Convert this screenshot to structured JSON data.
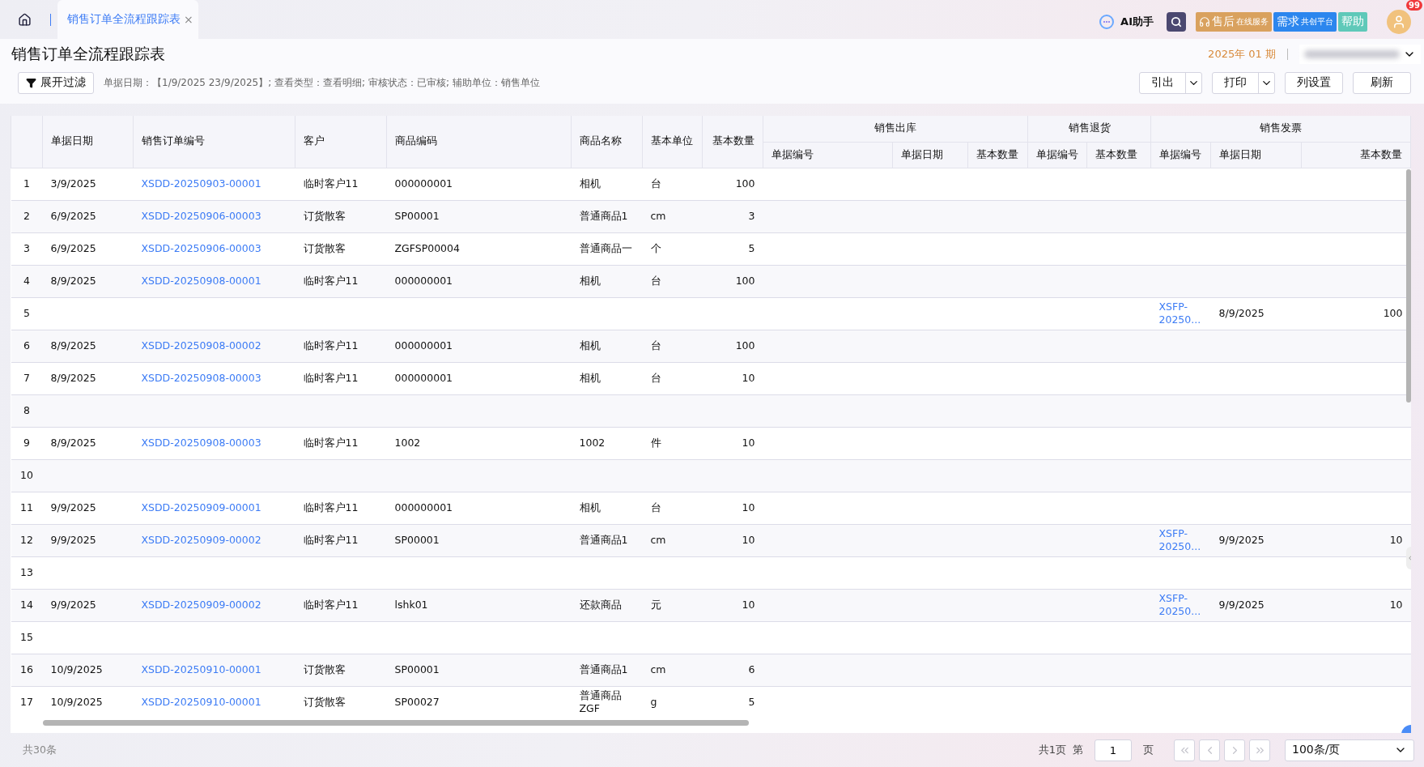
{
  "top_bar": {
    "tab": {
      "label": "销售订单全流程跟踪表",
      "close": "×",
      "selected": true
    },
    "ai_label": "AI助手",
    "service_button": {
      "main": "售后",
      "sub": "在线服务"
    },
    "platform_button": {
      "main": "需求",
      "sub": "共创平台"
    },
    "help_button": "帮助",
    "badge": "99"
  },
  "page": {
    "title": "销售订单全流程跟踪表",
    "period": "2025年 01 期"
  },
  "toolbar": {
    "filter_button": "展开过滤",
    "summary": "单据日期：【1/9/2025 23/9/2025】; 查看类型：查看明细; 审核状态：已审核; 辅助单位：销售单位",
    "buttons": [
      {
        "label": "引出",
        "kind": "split"
      },
      {
        "label": "打印",
        "kind": "split"
      },
      {
        "label": "列设置",
        "kind": "plain"
      },
      {
        "label": "刷新",
        "kind": "plain"
      }
    ]
  },
  "table": {
    "columns": [
      {
        "label": "单据日期"
      },
      {
        "label": "销售订单编号"
      },
      {
        "label": "客户"
      },
      {
        "label": "商品编码"
      },
      {
        "label": "商品名称"
      },
      {
        "label": "基本单位"
      },
      {
        "label": "基本数量"
      },
      {
        "label": "销售出库",
        "children": [
          {
            "label": "单据编号"
          },
          {
            "label": "单据日期"
          },
          {
            "label": "基本数量"
          }
        ]
      },
      {
        "label": "销售退货",
        "children": [
          {
            "label": "单据编号"
          },
          {
            "label": "基本数量"
          }
        ]
      },
      {
        "label": "销售发票",
        "children": [
          {
            "label": "单据编号"
          },
          {
            "label": "单据日期"
          },
          {
            "label": "基本数量"
          }
        ]
      }
    ],
    "rows": [
      {
        "no": "1",
        "date": "3/9/2025",
        "order_no": "XSDD-20250903-00001",
        "customer": "临时客户11",
        "item_code": "000000001",
        "item_name": "相机",
        "unit": "台",
        "qty": "100"
      },
      {
        "no": "2",
        "date": "6/9/2025",
        "order_no": "XSDD-20250906-00003",
        "customer": "订货散客",
        "item_code": "SP00001",
        "item_name": "普通商品1",
        "unit": "cm",
        "qty": "3"
      },
      {
        "no": "3",
        "date": "6/9/2025",
        "order_no": "XSDD-20250906-00003",
        "customer": "订货散客",
        "item_code": "ZGFSP00004",
        "item_name": "普通商品一",
        "unit": "个",
        "qty": "5"
      },
      {
        "no": "4",
        "date": "8/9/2025",
        "order_no": "XSDD-20250908-00001",
        "customer": "临时客户11",
        "item_code": "000000001",
        "item_name": "相机",
        "unit": "台",
        "qty": "100"
      },
      {
        "no": "5",
        "invoice_no": "XSFP-20250...",
        "invoice_date": "8/9/2025",
        "invoice_qty": "100"
      },
      {
        "no": "6",
        "date": "8/9/2025",
        "order_no": "XSDD-20250908-00002",
        "customer": "临时客户11",
        "item_code": "000000001",
        "item_name": "相机",
        "unit": "台",
        "qty": "100"
      },
      {
        "no": "7",
        "date": "8/9/2025",
        "order_no": "XSDD-20250908-00003",
        "customer": "临时客户11",
        "item_code": "000000001",
        "item_name": "相机",
        "unit": "台",
        "qty": "10"
      },
      {
        "no": "8"
      },
      {
        "no": "9",
        "date": "8/9/2025",
        "order_no": "XSDD-20250908-00003",
        "customer": "临时客户11",
        "item_code": "1002",
        "item_name": "1002",
        "unit": "件",
        "qty": "10"
      },
      {
        "no": "10"
      },
      {
        "no": "11",
        "date": "9/9/2025",
        "order_no": "XSDD-20250909-00001",
        "customer": "临时客户11",
        "item_code": "000000001",
        "item_name": "相机",
        "unit": "台",
        "qty": "10"
      },
      {
        "no": "12",
        "date": "9/9/2025",
        "order_no": "XSDD-20250909-00002",
        "customer": "临时客户11",
        "item_code": "SP00001",
        "item_name": "普通商品1",
        "unit": "cm",
        "qty": "10",
        "invoice_no": "XSFP-20250...",
        "invoice_date": "9/9/2025",
        "invoice_qty": "10"
      },
      {
        "no": "13"
      },
      {
        "no": "14",
        "date": "9/9/2025",
        "order_no": "XSDD-20250909-00002",
        "customer": "临时客户11",
        "item_code": "lshk01",
        "item_name": "还款商品",
        "unit": "元",
        "qty": "10",
        "invoice_no": "XSFP-20250...",
        "invoice_date": "9/9/2025",
        "invoice_qty": "10"
      },
      {
        "no": "15"
      },
      {
        "no": "16",
        "date": "10/9/2025",
        "order_no": "XSDD-20250910-00001",
        "customer": "订货散客",
        "item_code": "SP00001",
        "item_name": "普通商品1",
        "unit": "cm",
        "qty": "6"
      },
      {
        "no": "17",
        "date": "10/9/2025",
        "order_no": "XSDD-20250910-00001",
        "customer": "订货散客",
        "item_code": "SP00027",
        "item_name": "普通商品ZGF",
        "unit": "g",
        "qty": "5"
      }
    ]
  },
  "pagination": {
    "total": "共30条",
    "pages": "共1页",
    "page_prefix": "第",
    "page": "1",
    "page_suffix": "页",
    "nav": [
      {
        "kind": "first",
        "disabled": true
      },
      {
        "kind": "prev",
        "disabled": true
      },
      {
        "kind": "next",
        "disabled": true
      },
      {
        "kind": "last",
        "disabled": true
      }
    ],
    "page_size": "100条/页"
  }
}
